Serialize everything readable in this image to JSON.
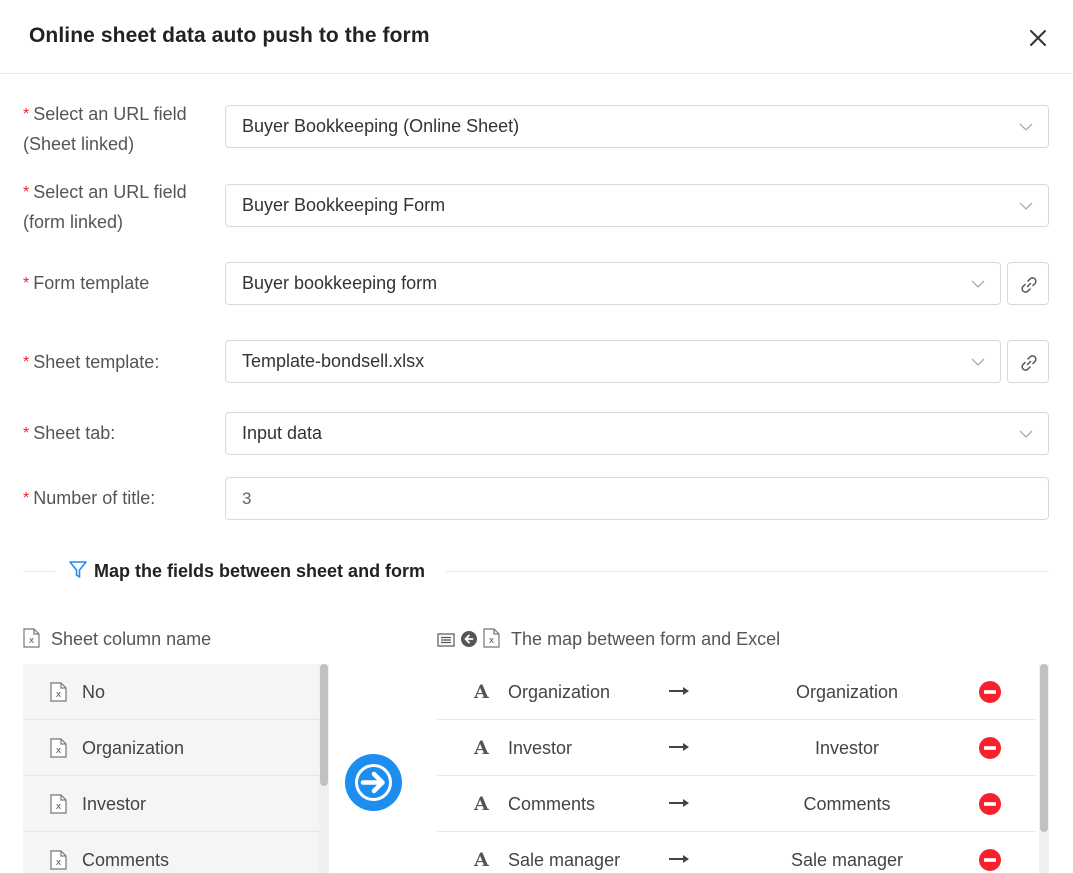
{
  "dialog": {
    "title": "Online sheet data auto push to the form"
  },
  "form": {
    "required_mark": "*",
    "url_sheet": {
      "label_line1": "Select an URL field",
      "label_line2": "(Sheet linked)",
      "value": "Buyer Bookkeeping (Online Sheet)"
    },
    "url_form": {
      "label_line1": "Select an URL field",
      "label_line2": "(form linked)",
      "value": "Buyer Bookkeeping Form"
    },
    "form_template": {
      "label": "Form template",
      "value": "Buyer bookkeeping form"
    },
    "sheet_template": {
      "label": "Sheet template:",
      "value": "Template-bondsell.xlsx"
    },
    "sheet_tab": {
      "label": "Sheet tab:",
      "value": "Input data"
    },
    "title_count": {
      "label": "Number of title:",
      "value": "3"
    }
  },
  "mapping": {
    "section_title": "Map the fields between sheet and form",
    "left_header": "Sheet column name",
    "right_header": "The map between form and Excel",
    "sheet_columns": [
      {
        "label": "No"
      },
      {
        "label": "Organization"
      },
      {
        "label": "Investor"
      },
      {
        "label": "Comments"
      }
    ],
    "field_type_glyph": "A",
    "maps": [
      {
        "form_field": "Organization",
        "excel_column": "Organization"
      },
      {
        "form_field": "Investor",
        "excel_column": "Investor"
      },
      {
        "form_field": "Comments",
        "excel_column": "Comments"
      },
      {
        "form_field": "Sale manager",
        "excel_column": "Sale manager"
      }
    ]
  },
  "colors": {
    "accent": "#1d8ef0",
    "required": "#f5222d",
    "remove": "#f5222d"
  }
}
